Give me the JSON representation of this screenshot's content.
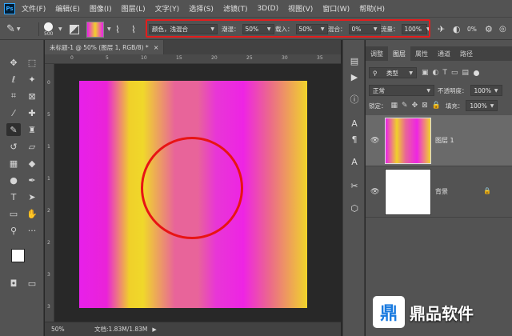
{
  "app": {
    "logo": "Ps"
  },
  "menu": [
    "文件(F)",
    "编辑(E)",
    "图像(I)",
    "图层(L)",
    "文字(Y)",
    "选择(S)",
    "滤镜(T)",
    "3D(D)",
    "视图(V)",
    "窗口(W)",
    "帮助(H)"
  ],
  "options": {
    "brush_size": "500",
    "mode_value": "颜色，浅混合",
    "wetness_label": "潮湿：",
    "wetness_value": "50%",
    "load_label": "载入：",
    "load_value": "50%",
    "mix_label": "混合：",
    "mix_value": "0%",
    "flow_label": "流量：",
    "flow_value": "100%",
    "smoothing_value": "0%",
    "colors": {
      "highlight": "#e31d1d",
      "panel_bg": "#535353"
    }
  },
  "document": {
    "tab_title": "未标题-1 @ 50% (图层 1, RGB/8) *",
    "ruler_h": [
      "0",
      "5",
      "10",
      "15",
      "20",
      "25",
      "30",
      "35"
    ],
    "ruler_v": [
      "0",
      "5",
      "1",
      "1",
      "2",
      "2",
      "3",
      "3"
    ],
    "zoom": "50%",
    "doc_info": "文档:1.83M/1.83M"
  },
  "layers_panel": {
    "tabs": [
      "调整",
      "图层",
      "属性",
      "通道",
      "路径"
    ],
    "active_tab": "图层",
    "filter_type": "类型",
    "blend_mode": "正常",
    "opacity_label": "不透明度：",
    "opacity_value": "100%",
    "lock_label": "锁定：",
    "fill_label": "填充：",
    "fill_value": "100%",
    "layers": [
      {
        "name": "图层 1",
        "visible": true,
        "selected": true
      },
      {
        "name": "背景",
        "visible": true,
        "locked": true
      }
    ]
  },
  "watermark": {
    "logo": "鼎",
    "text": "鼎品软件"
  }
}
